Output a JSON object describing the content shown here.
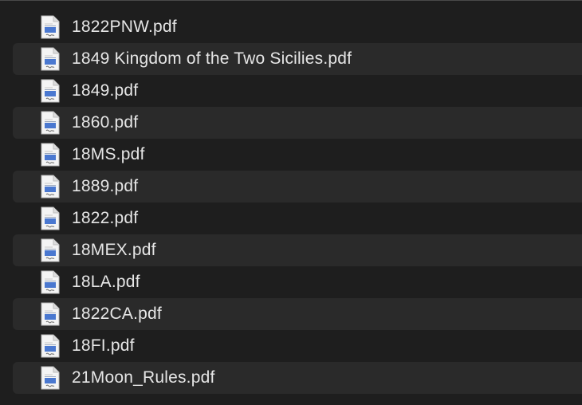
{
  "files": [
    {
      "name": "1822PNW.pdf",
      "icon": "pdf-document-icon"
    },
    {
      "name": "1849 Kingdom of the Two Sicilies.pdf",
      "icon": "pdf-document-icon"
    },
    {
      "name": "1849.pdf",
      "icon": "pdf-document-icon"
    },
    {
      "name": "1860.pdf",
      "icon": "pdf-document-icon"
    },
    {
      "name": "18MS.pdf",
      "icon": "pdf-document-icon"
    },
    {
      "name": "1889.pdf",
      "icon": "pdf-document-icon"
    },
    {
      "name": "1822.pdf",
      "icon": "pdf-document-icon"
    },
    {
      "name": "18MEX.pdf",
      "icon": "pdf-document-icon"
    },
    {
      "name": "18LA.pdf",
      "icon": "pdf-document-icon"
    },
    {
      "name": "1822CA.pdf",
      "icon": "pdf-document-icon"
    },
    {
      "name": "18FI.pdf",
      "icon": "pdf-document-icon"
    },
    {
      "name": "21Moon_Rules.pdf",
      "icon": "pdf-document-icon"
    }
  ],
  "colors": {
    "background": "#1e1e1e",
    "alt_row": "#2a2a2a",
    "text": "#e6e6e6",
    "icon_accent": "#4a78d0"
  }
}
